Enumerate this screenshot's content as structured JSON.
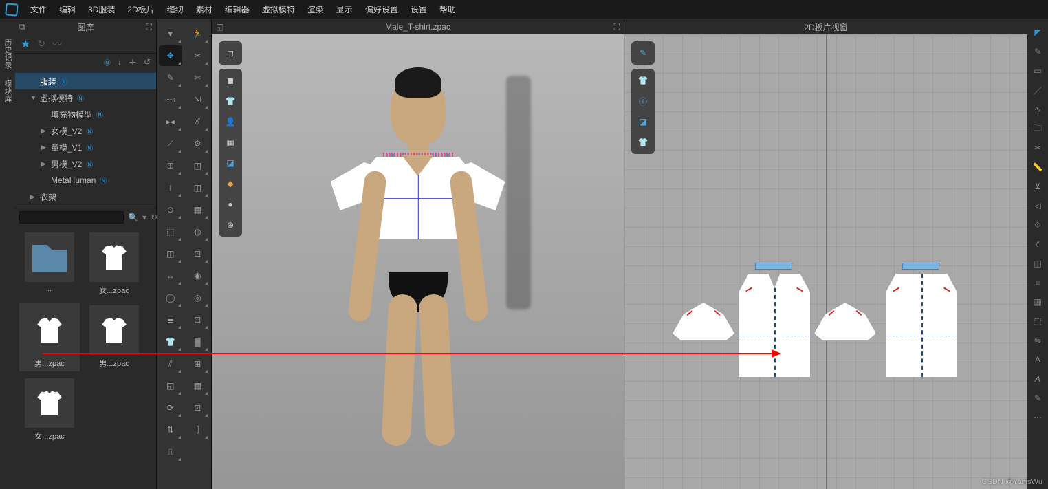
{
  "menu": {
    "items": [
      "文件",
      "编辑",
      "3D服装",
      "2D板片",
      "缝纫",
      "素材",
      "编辑器",
      "虚拟模特",
      "渲染",
      "显示",
      "偏好设置",
      "设置",
      "帮助"
    ]
  },
  "side_tabs": {
    "history": "历史记录",
    "modules": "模块库"
  },
  "library": {
    "title": "图库",
    "tree": {
      "t0": "服装",
      "t1": "虚拟模特",
      "t2": "填充物模型",
      "t3": "女模_V2",
      "t4": "童模_V1",
      "t5": "男模_V2",
      "t6": "MetaHuman",
      "t7": "衣架"
    },
    "search_placeholder": "",
    "thumbs": {
      "th0": "..",
      "th1": "女...zpac",
      "th2": "男...zpac",
      "th3": "男...zpac",
      "th4": "女...zpac"
    }
  },
  "viewport3d": {
    "title": "Male_T-shirt.zpac"
  },
  "viewport2d": {
    "title": "2D板片视窗"
  },
  "watermark": "CSDN @YanisWu",
  "colors": {
    "accent": "#2d9cdb",
    "panel": "#2a2a2a",
    "dark": "#1a1a1a"
  }
}
